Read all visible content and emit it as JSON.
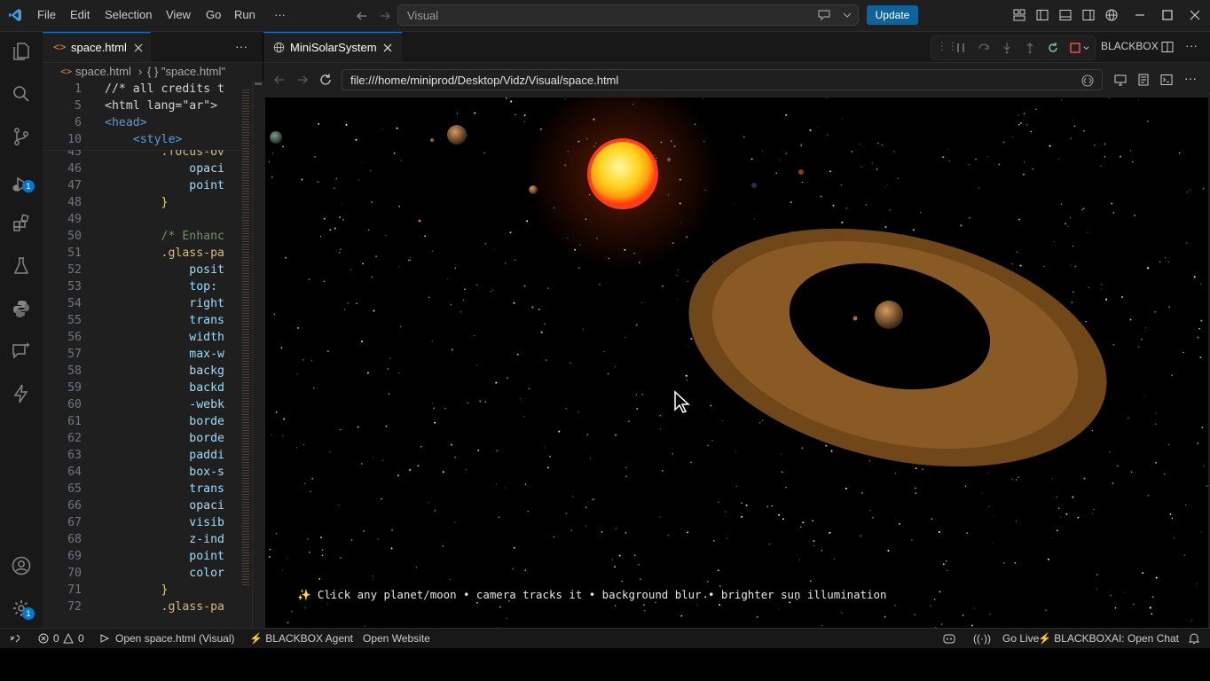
{
  "titlebar": {
    "menu": [
      "File",
      "Edit",
      "Selection",
      "View",
      "Go",
      "Run",
      "···"
    ],
    "search_text": "Visual",
    "update_label": "Update"
  },
  "activity": {
    "debug_badge": "1",
    "settings_badge": "1"
  },
  "editor": {
    "tab_label": "space.html",
    "breadcrumb_file": "space.html",
    "breadcrumb_symbol": "{ } \"space.html\"",
    "sticky_lines": [
      {
        "num": "1",
        "text": "//* all credits t"
      },
      {
        "num": "5",
        "text": "<html lang=\"ar\">"
      },
      {
        "num": "6",
        "text": "<head>"
      },
      {
        "num": "10",
        "text": "    <style>"
      }
    ],
    "lines": [
      {
        "num": "45",
        "text": "        .focus-ov"
      },
      {
        "num": "46",
        "text": "            opaci"
      },
      {
        "num": "47",
        "text": "            point"
      },
      {
        "num": "48",
        "text": "        }"
      },
      {
        "num": "49",
        "text": ""
      },
      {
        "num": "50",
        "text": "        /* Enhanc"
      },
      {
        "num": "51",
        "text": "        .glass-pa"
      },
      {
        "num": "52",
        "text": "            posit"
      },
      {
        "num": "53",
        "text": "            top: "
      },
      {
        "num": "54",
        "text": "            right"
      },
      {
        "num": "55",
        "text": "            trans"
      },
      {
        "num": "56",
        "text": "            width"
      },
      {
        "num": "57",
        "text": "            max-w"
      },
      {
        "num": "58",
        "text": "            backg"
      },
      {
        "num": "59",
        "text": "            backd"
      },
      {
        "num": "60",
        "text": "            -webk"
      },
      {
        "num": "61",
        "text": "            borde"
      },
      {
        "num": "62",
        "text": "            borde"
      },
      {
        "num": "63",
        "text": "            paddi"
      },
      {
        "num": "64",
        "text": "            box-s"
      },
      {
        "num": "65",
        "text": "            trans"
      },
      {
        "num": "66",
        "text": "            opaci"
      },
      {
        "num": "67",
        "text": "            visib"
      },
      {
        "num": "68",
        "text": "            z-ind"
      },
      {
        "num": "69",
        "text": "            point"
      },
      {
        "num": "70",
        "text": "            color"
      },
      {
        "num": "71",
        "text": "        }"
      },
      {
        "num": "72",
        "text": "        .glass-pa"
      }
    ]
  },
  "preview": {
    "tab_label": "MiniSolarSystem",
    "toolbar_label": "BLACKBOX",
    "url": "file:///home/miniprod/Desktop/Vidz/Visual/space.html",
    "hint": "✨ Click any planet/moon • camera tracks it • background blur • brighter sun illumination"
  },
  "status": {
    "errors": "0",
    "warnings": "0",
    "open_item": "Open space.html (Visual)",
    "agent": "⚡ BLACKBOX Agent",
    "open_website": "Open Website",
    "go_live": "Go Live",
    "open_chat": "⚡ BLACKBOXAI: Open Chat"
  },
  "colors": {
    "accent": "#0078d4",
    "update_button": "#0e639c",
    "sun": "#ffd21a",
    "ring": "#8a5a24"
  }
}
